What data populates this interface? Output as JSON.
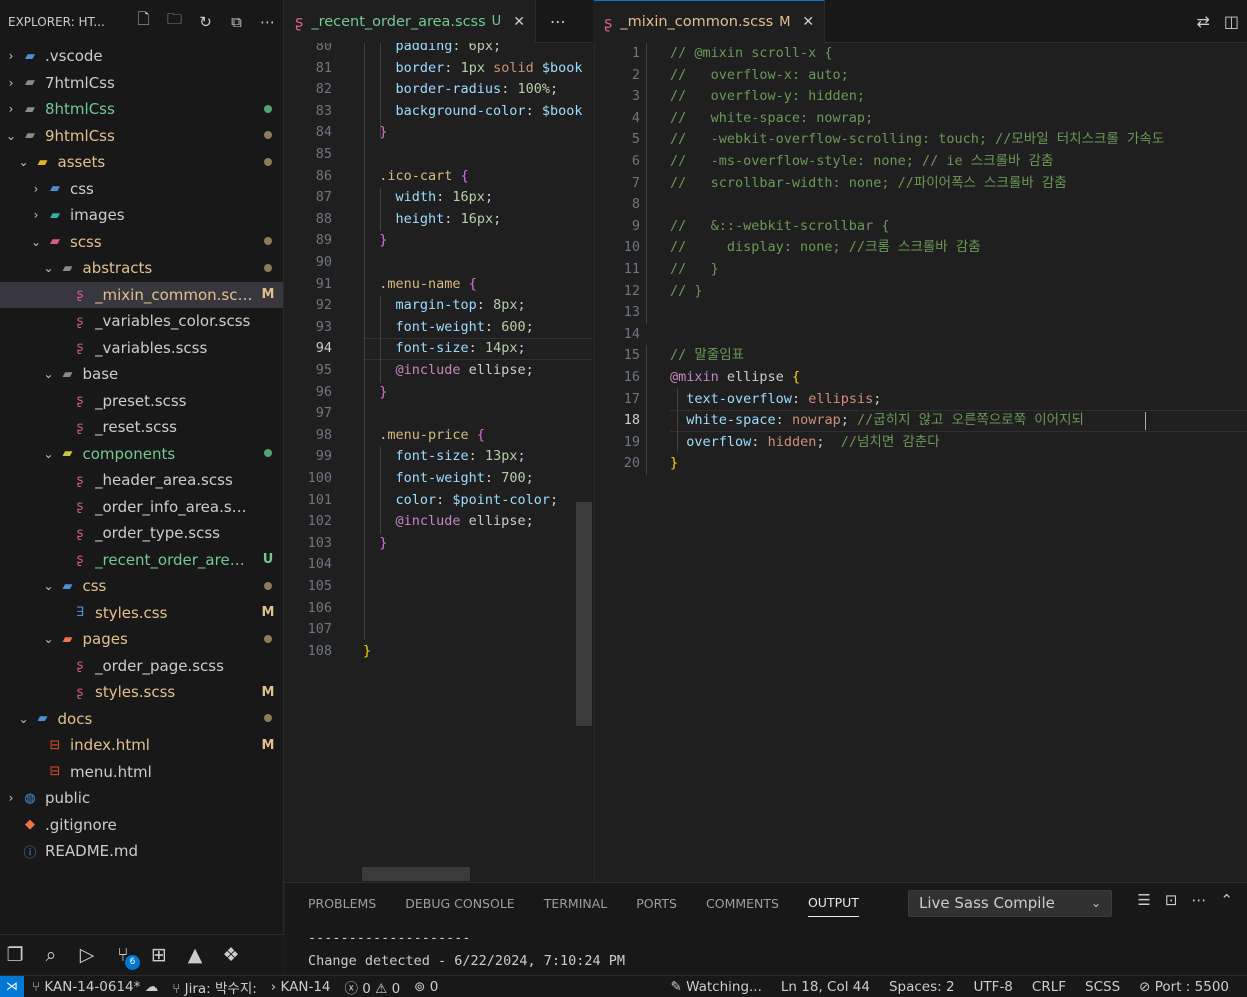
{
  "sidebar": {
    "title": "EXPLORER: HT...",
    "actions": [
      {
        "name": "new-file-icon",
        "glyph": "🗋"
      },
      {
        "name": "new-folder-icon",
        "glyph": "🗀"
      },
      {
        "name": "refresh-icon",
        "glyph": "↻"
      },
      {
        "name": "collapse-all-icon",
        "glyph": "⧉"
      },
      {
        "name": "more-icon",
        "glyph": "⋯"
      }
    ],
    "tree": [
      {
        "label": ".vscode",
        "depth": 0,
        "twisty": "›",
        "icon": "vscode-folder-icon",
        "glyph": "▰",
        "color": "#cccccc",
        "iconColor": "#4a8fd8",
        "badge": "",
        "dot": ""
      },
      {
        "label": "7htmlCss",
        "depth": 0,
        "twisty": "›",
        "icon": "folder-icon",
        "glyph": "▰",
        "color": "#cccccc",
        "iconColor": "#8a8a8a",
        "badge": "",
        "dot": ""
      },
      {
        "label": "8htmlCss",
        "depth": 0,
        "twisty": "›",
        "icon": "folder-icon",
        "glyph": "▰",
        "color": "#73c991",
        "iconColor": "#8a8a8a",
        "badge": "",
        "dot": "#56a271"
      },
      {
        "label": "9htmlCss",
        "depth": 0,
        "twisty": "⌄",
        "icon": "folder-open-icon",
        "glyph": "▰",
        "color": "#e2c08d",
        "iconColor": "#8a8a8a",
        "badge": "",
        "dot": "#8f7a59"
      },
      {
        "label": "assets",
        "depth": 1,
        "twisty": "⌄",
        "icon": "assets-folder-icon",
        "glyph": "▰",
        "color": "#e2c08d",
        "iconColor": "#e6b422",
        "badge": "",
        "dot": "#8f7a59"
      },
      {
        "label": "css",
        "depth": 2,
        "twisty": "›",
        "icon": "css-folder-icon",
        "glyph": "▰",
        "color": "#cccccc",
        "iconColor": "#4a8fd8",
        "badge": "",
        "dot": ""
      },
      {
        "label": "images",
        "depth": 2,
        "twisty": "›",
        "icon": "images-folder-icon",
        "glyph": "▰",
        "color": "#cccccc",
        "iconColor": "#2fb0a0",
        "badge": "",
        "dot": ""
      },
      {
        "label": "scss",
        "depth": 2,
        "twisty": "⌄",
        "icon": "scss-folder-icon",
        "glyph": "▰",
        "color": "#e2c08d",
        "iconColor": "#d35f8a",
        "badge": "",
        "dot": "#8f7a59"
      },
      {
        "label": "abstracts",
        "depth": 3,
        "twisty": "⌄",
        "icon": "folder-open-icon",
        "glyph": "▰",
        "color": "#e2c08d",
        "iconColor": "#8a8a8a",
        "badge": "",
        "dot": "#8f7a59"
      },
      {
        "label": "_mixin_common.scss",
        "depth": 4,
        "twisty": "",
        "icon": "sass-file-icon",
        "glyph": "ʂ",
        "color": "#e2c08d",
        "iconColor": "#d35f8a",
        "badge": "M",
        "dot": "",
        "selected": true
      },
      {
        "label": "_variables_color.scss",
        "depth": 4,
        "twisty": "",
        "icon": "sass-file-icon",
        "glyph": "ʂ",
        "color": "#cccccc",
        "iconColor": "#d35f8a",
        "badge": "",
        "dot": ""
      },
      {
        "label": "_variables.scss",
        "depth": 4,
        "twisty": "",
        "icon": "sass-file-icon",
        "glyph": "ʂ",
        "color": "#cccccc",
        "iconColor": "#d35f8a",
        "badge": "",
        "dot": ""
      },
      {
        "label": "base",
        "depth": 3,
        "twisty": "⌄",
        "icon": "folder-open-icon",
        "glyph": "▰",
        "color": "#cccccc",
        "iconColor": "#8a8a8a",
        "badge": "",
        "dot": ""
      },
      {
        "label": "_preset.scss",
        "depth": 4,
        "twisty": "",
        "icon": "sass-file-icon",
        "glyph": "ʂ",
        "color": "#cccccc",
        "iconColor": "#d35f8a",
        "badge": "",
        "dot": ""
      },
      {
        "label": "_reset.scss",
        "depth": 4,
        "twisty": "",
        "icon": "sass-file-icon",
        "glyph": "ʂ",
        "color": "#cccccc",
        "iconColor": "#d35f8a",
        "badge": "",
        "dot": ""
      },
      {
        "label": "components",
        "depth": 3,
        "twisty": "⌄",
        "icon": "components-folder-icon",
        "glyph": "▰",
        "color": "#73c991",
        "iconColor": "#c6c63a",
        "badge": "",
        "dot": "#56a271"
      },
      {
        "label": "_header_area.scss",
        "depth": 4,
        "twisty": "",
        "icon": "sass-file-icon",
        "glyph": "ʂ",
        "color": "#cccccc",
        "iconColor": "#d35f8a",
        "badge": "",
        "dot": ""
      },
      {
        "label": "_order_info_area.scss",
        "depth": 4,
        "twisty": "",
        "icon": "sass-file-icon",
        "glyph": "ʂ",
        "color": "#cccccc",
        "iconColor": "#d35f8a",
        "badge": "",
        "dot": ""
      },
      {
        "label": "_order_type.scss",
        "depth": 4,
        "twisty": "",
        "icon": "sass-file-icon",
        "glyph": "ʂ",
        "color": "#cccccc",
        "iconColor": "#d35f8a",
        "badge": "",
        "dot": ""
      },
      {
        "label": "_recent_order_area.sc...",
        "depth": 4,
        "twisty": "",
        "icon": "sass-file-icon",
        "glyph": "ʂ",
        "color": "#73c991",
        "iconColor": "#d35f8a",
        "badge": "U",
        "dot": ""
      },
      {
        "label": "css",
        "depth": 3,
        "twisty": "⌄",
        "icon": "css-folder-icon",
        "glyph": "▰",
        "color": "#e2c08d",
        "iconColor": "#4a8fd8",
        "badge": "",
        "dot": "#8f7a59"
      },
      {
        "label": "styles.css",
        "depth": 4,
        "twisty": "",
        "icon": "css-file-icon",
        "glyph": "∃",
        "color": "#e2c08d",
        "iconColor": "#4a8fd8",
        "badge": "M",
        "dot": ""
      },
      {
        "label": "pages",
        "depth": 3,
        "twisty": "⌄",
        "icon": "pages-folder-icon",
        "glyph": "▰",
        "color": "#e2c08d",
        "iconColor": "#e8744a",
        "badge": "",
        "dot": "#8f7a59"
      },
      {
        "label": "_order_page.scss",
        "depth": 4,
        "twisty": "",
        "icon": "sass-file-icon",
        "glyph": "ʂ",
        "color": "#cccccc",
        "iconColor": "#d35f8a",
        "badge": "",
        "dot": ""
      },
      {
        "label": "styles.scss",
        "depth": 4,
        "twisty": "",
        "icon": "sass-file-icon",
        "glyph": "ʂ",
        "color": "#e2c08d",
        "iconColor": "#d35f8a",
        "badge": "M",
        "dot": ""
      },
      {
        "label": "docs",
        "depth": 1,
        "twisty": "⌄",
        "icon": "docs-folder-icon",
        "glyph": "▰",
        "color": "#e2c08d",
        "iconColor": "#4a8fd8",
        "badge": "",
        "dot": "#8f7a59"
      },
      {
        "label": "index.html",
        "depth": 2,
        "twisty": "",
        "icon": "html-file-icon",
        "glyph": "⊟",
        "color": "#e2c08d",
        "iconColor": "#e44d26",
        "badge": "M",
        "dot": ""
      },
      {
        "label": "menu.html",
        "depth": 2,
        "twisty": "",
        "icon": "html-file-icon",
        "glyph": "⊟",
        "color": "#cccccc",
        "iconColor": "#e44d26",
        "badge": "",
        "dot": ""
      },
      {
        "label": "public",
        "depth": 0,
        "twisty": "›",
        "icon": "public-folder-icon",
        "glyph": "◍",
        "color": "#cccccc",
        "iconColor": "#4a8fd8",
        "badge": "",
        "dot": ""
      },
      {
        "label": ".gitignore",
        "depth": 0,
        "twisty": "",
        "icon": "git-file-icon",
        "glyph": "◆",
        "color": "#cccccc",
        "iconColor": "#e8744a",
        "badge": "",
        "dot": ""
      },
      {
        "label": "README.md",
        "depth": 0,
        "twisty": "",
        "icon": "info-file-icon",
        "glyph": "ⓘ",
        "color": "#cccccc",
        "iconColor": "#4a8fd8",
        "badge": "",
        "dot": ""
      }
    ]
  },
  "editor1": {
    "tab": {
      "label": "_recent_order_area.scss",
      "marker": "U",
      "close": "✕"
    },
    "more": "⋯",
    "first_line": 80,
    "active_line": 94,
    "lines": [
      [
        [
          "    ",
          ""
        ],
        [
          "padding",
          "t-prop"
        ],
        [
          ": 6px;",
          "t-num"
        ]
      ],
      [
        [
          "    ",
          ""
        ],
        [
          "border",
          "t-prop"
        ],
        [
          ": ",
          ""
        ],
        [
          "1px",
          "t-num"
        ],
        [
          " solid ",
          "t-val"
        ],
        [
          "$book",
          "t-var"
        ]
      ],
      [
        [
          "    ",
          ""
        ],
        [
          "border-radius",
          "t-prop"
        ],
        [
          ": ",
          ""
        ],
        [
          "100%",
          "t-num"
        ],
        [
          ";",
          ""
        ]
      ],
      [
        [
          "    ",
          ""
        ],
        [
          "background-color",
          "t-prop"
        ],
        [
          ": ",
          ""
        ],
        [
          "$book",
          "t-var"
        ]
      ],
      [
        [
          "  ",
          ""
        ],
        [
          "}",
          "t-brace"
        ]
      ],
      [
        [
          "",
          ""
        ]
      ],
      [
        [
          "  ",
          ""
        ],
        [
          ".ico-cart",
          "t-sel"
        ],
        [
          " ",
          ""
        ],
        [
          "{",
          "t-brace"
        ]
      ],
      [
        [
          "    ",
          ""
        ],
        [
          "width",
          "t-prop"
        ],
        [
          ": ",
          ""
        ],
        [
          "16px",
          "t-num"
        ],
        [
          ";",
          ""
        ]
      ],
      [
        [
          "    ",
          ""
        ],
        [
          "height",
          "t-prop"
        ],
        [
          ": ",
          ""
        ],
        [
          "16px",
          "t-num"
        ],
        [
          ";",
          ""
        ]
      ],
      [
        [
          "  ",
          ""
        ],
        [
          "}",
          "t-brace"
        ]
      ],
      [
        [
          "",
          ""
        ]
      ],
      [
        [
          "  ",
          ""
        ],
        [
          ".menu-name",
          "t-sel"
        ],
        [
          " ",
          ""
        ],
        [
          "{",
          "t-brace"
        ]
      ],
      [
        [
          "    ",
          ""
        ],
        [
          "margin-top",
          "t-prop"
        ],
        [
          ": ",
          ""
        ],
        [
          "8px",
          "t-num"
        ],
        [
          ";",
          ""
        ]
      ],
      [
        [
          "    ",
          ""
        ],
        [
          "font-weight",
          "t-prop"
        ],
        [
          ": ",
          ""
        ],
        [
          "600",
          "t-num"
        ],
        [
          ";",
          ""
        ]
      ],
      [
        [
          "    ",
          ""
        ],
        [
          "font-size",
          "t-prop"
        ],
        [
          ": ",
          ""
        ],
        [
          "14px",
          "t-num"
        ],
        [
          ";",
          ""
        ]
      ],
      [
        [
          "    ",
          ""
        ],
        [
          "@include",
          "t-at"
        ],
        [
          " ellipse;",
          ""
        ]
      ],
      [
        [
          "  ",
          ""
        ],
        [
          "}",
          "t-brace"
        ]
      ],
      [
        [
          "",
          ""
        ]
      ],
      [
        [
          "  ",
          ""
        ],
        [
          ".menu-price",
          "t-sel"
        ],
        [
          " ",
          ""
        ],
        [
          "{",
          "t-brace"
        ]
      ],
      [
        [
          "    ",
          ""
        ],
        [
          "font-size",
          "t-prop"
        ],
        [
          ": ",
          ""
        ],
        [
          "13px",
          "t-num"
        ],
        [
          ";",
          ""
        ]
      ],
      [
        [
          "    ",
          ""
        ],
        [
          "font-weight",
          "t-prop"
        ],
        [
          ": ",
          ""
        ],
        [
          "700",
          "t-num"
        ],
        [
          ";",
          ""
        ]
      ],
      [
        [
          "    ",
          ""
        ],
        [
          "color",
          "t-prop"
        ],
        [
          ": ",
          ""
        ],
        [
          "$point-color",
          "t-var"
        ],
        [
          ";",
          ""
        ]
      ],
      [
        [
          "    ",
          ""
        ],
        [
          "@include",
          "t-at"
        ],
        [
          " ellipse;",
          ""
        ]
      ],
      [
        [
          "  ",
          ""
        ],
        [
          "}",
          "t-brace"
        ]
      ],
      [
        [
          "",
          ""
        ]
      ],
      [
        [
          "",
          ""
        ]
      ],
      [
        [
          "",
          ""
        ]
      ],
      [
        [
          "",
          ""
        ]
      ],
      [
        [
          "}",
          "t-brace2"
        ]
      ]
    ]
  },
  "editor2": {
    "tab": {
      "label": "_mixin_common.scss",
      "marker": "M",
      "close": "✕"
    },
    "actions": [
      {
        "name": "compare-changes-icon",
        "glyph": "⇄"
      },
      {
        "name": "split-editor-icon",
        "glyph": "◫"
      }
    ],
    "first_line": 1,
    "active_line": 18,
    "lines": [
      [
        [
          "// @mixin scroll-x {",
          "t-cm"
        ]
      ],
      [
        [
          "//   overflow-x: auto;",
          "t-cm"
        ]
      ],
      [
        [
          "//   overflow-y: hidden;",
          "t-cm"
        ]
      ],
      [
        [
          "//   white-space: nowrap;",
          "t-cm"
        ]
      ],
      [
        [
          "//   -webkit-overflow-scrolling: touch; //모바일 터치스크롤 가속도",
          "t-cm"
        ]
      ],
      [
        [
          "//   -ms-overflow-style: none; // ie 스크롤바 감춤",
          "t-cm"
        ]
      ],
      [
        [
          "//   scrollbar-width: none; //파이어폭스 스크롤바 감춤",
          "t-cm"
        ]
      ],
      [
        [
          "",
          ""
        ]
      ],
      [
        [
          "//   &::-webkit-scrollbar {",
          "t-cm"
        ]
      ],
      [
        [
          "//     display: none; //크롬 스크롤바 감춤",
          "t-cm"
        ]
      ],
      [
        [
          "//   }",
          "t-cm"
        ]
      ],
      [
        [
          "// }",
          "t-cm"
        ]
      ],
      [
        [
          "",
          ""
        ]
      ],
      [
        [
          "",
          ""
        ]
      ],
      [
        [
          "// 말줄임표",
          "t-cm"
        ]
      ],
      [
        [
          "@mixin",
          "t-at"
        ],
        [
          " ellipse ",
          ""
        ],
        [
          "{",
          "t-brace2"
        ]
      ],
      [
        [
          "  ",
          ""
        ],
        [
          "text-overflow",
          "t-prop"
        ],
        [
          ": ",
          ""
        ],
        [
          "ellipsis",
          "t-val"
        ],
        [
          ";",
          ""
        ]
      ],
      [
        [
          "  ",
          ""
        ],
        [
          "white-space",
          "t-prop"
        ],
        [
          ": ",
          ""
        ],
        [
          "nowrap",
          "t-val"
        ],
        [
          "; ",
          ""
        ],
        [
          "//굽히지 않고 오른쪽으로쭉 이어지되",
          "t-cm"
        ]
      ],
      [
        [
          "  ",
          ""
        ],
        [
          "overflow",
          "t-prop"
        ],
        [
          ": ",
          ""
        ],
        [
          "hidden",
          "t-val"
        ],
        [
          ";  ",
          ""
        ],
        [
          "//넘치면 감춘다",
          "t-cm"
        ]
      ],
      [
        [
          "}",
          "t-brace2"
        ]
      ]
    ]
  },
  "panel": {
    "tabs": [
      "PROBLEMS",
      "DEBUG CONSOLE",
      "TERMINAL",
      "PORTS",
      "COMMENTS",
      "OUTPUT"
    ],
    "active_tab": "OUTPUT",
    "output_channel": "Live Sass Compile",
    "actions": [
      {
        "name": "clear-output-icon",
        "glyph": "☰"
      },
      {
        "name": "lock-scroll-icon",
        "glyph": "⊡"
      },
      {
        "name": "more-icon",
        "glyph": "⋯"
      },
      {
        "name": "maximize-panel-icon",
        "glyph": "⌃"
      }
    ],
    "output_lines": [
      "--------------------",
      "Change detected - 6/22/2024, 7:10:24 PM"
    ]
  },
  "activity": [
    {
      "name": "explorer-icon",
      "glyph": "❐"
    },
    {
      "name": "search-icon",
      "glyph": "⌕"
    },
    {
      "name": "run-debug-icon",
      "glyph": "▷"
    },
    {
      "name": "source-control-icon",
      "glyph": "⑂",
      "badge": "6"
    },
    {
      "name": "extensions-icon",
      "glyph": "⊞"
    },
    {
      "name": "remote-icon",
      "glyph": "▲"
    },
    {
      "name": "figma-icon",
      "glyph": "❖"
    }
  ],
  "status": {
    "remote_glyph": "⋊",
    "branch": "KAN-14-0614*",
    "sync_glyph": "☁",
    "jira": "Jira: 박수지:",
    "issue": "KAN-14",
    "errors": "0",
    "warnings": "0",
    "ports": "0",
    "watching": "Watching...",
    "position": "Ln 18, Col 44",
    "spaces": "Spaces: 2",
    "encoding": "UTF-8",
    "eol": "CRLF",
    "language": "SCSS",
    "port": "Port : 5500"
  }
}
